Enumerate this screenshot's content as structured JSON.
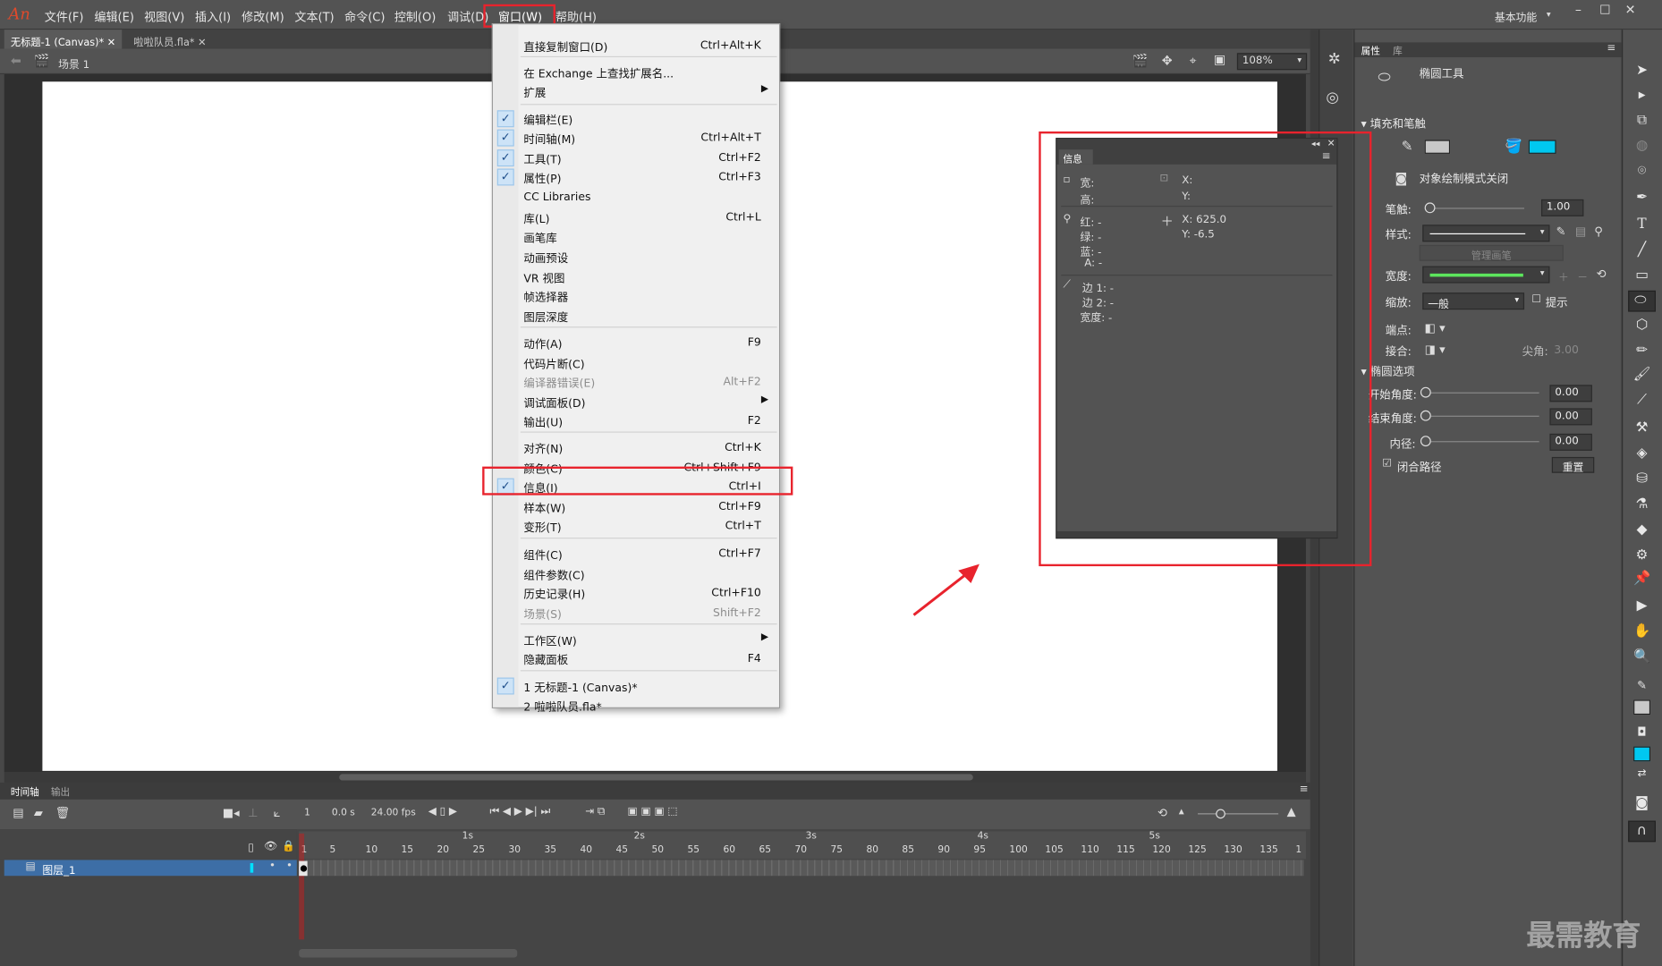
{
  "app": {
    "logo": "An",
    "accent": "#e8232d"
  },
  "menubar": {
    "items": [
      "文件(F)",
      "编辑(E)",
      "视图(V)",
      "插入(I)",
      "修改(M)",
      "文本(T)",
      "命令(C)",
      "控制(O)",
      "调试(D)",
      "窗口(W)",
      "帮助(H)"
    ],
    "workspace": "基本功能"
  },
  "doc_tabs": [
    "无标题-1 (Canvas)*",
    "啦啦队员.fla*"
  ],
  "scene": {
    "label": "场景 1",
    "zoom": "108%"
  },
  "window_menu": {
    "items": [
      {
        "label": "直接复制窗口(D)",
        "shortcut": "Ctrl+Alt+K"
      },
      {
        "label": "在 Exchange 上查找扩展名...",
        "shortcut": ""
      },
      {
        "label": "扩展",
        "shortcut": "",
        "submenu": true
      },
      {
        "label": "编辑栏(E)",
        "shortcut": "",
        "checked": true
      },
      {
        "label": "时间轴(M)",
        "shortcut": "Ctrl+Alt+T",
        "checked": true
      },
      {
        "label": "工具(T)",
        "shortcut": "Ctrl+F2",
        "checked": true
      },
      {
        "label": "属性(P)",
        "shortcut": "Ctrl+F3",
        "checked": true
      },
      {
        "label": "CC Libraries",
        "shortcut": ""
      },
      {
        "label": "库(L)",
        "shortcut": "Ctrl+L"
      },
      {
        "label": "画笔库",
        "shortcut": ""
      },
      {
        "label": "动画预设",
        "shortcut": ""
      },
      {
        "label": "VR 视图",
        "shortcut": ""
      },
      {
        "label": "帧选择器",
        "shortcut": ""
      },
      {
        "label": "图层深度",
        "shortcut": ""
      },
      {
        "label": "动作(A)",
        "shortcut": "F9"
      },
      {
        "label": "代码片断(C)",
        "shortcut": ""
      },
      {
        "label": "编译器错误(E)",
        "shortcut": "Alt+F2",
        "disabled": true
      },
      {
        "label": "调试面板(D)",
        "shortcut": "",
        "submenu": true
      },
      {
        "label": "输出(U)",
        "shortcut": "F2"
      },
      {
        "label": "对齐(N)",
        "shortcut": "Ctrl+K"
      },
      {
        "label": "颜色(C)",
        "shortcut": "Ctrl+Shift+F9"
      },
      {
        "label": "信息(I)",
        "shortcut": "Ctrl+I",
        "checked": true
      },
      {
        "label": "样本(W)",
        "shortcut": "Ctrl+F9"
      },
      {
        "label": "变形(T)",
        "shortcut": "Ctrl+T"
      },
      {
        "label": "组件(C)",
        "shortcut": "Ctrl+F7"
      },
      {
        "label": "组件参数(C)",
        "shortcut": ""
      },
      {
        "label": "历史记录(H)",
        "shortcut": "Ctrl+F10"
      },
      {
        "label": "场景(S)",
        "shortcut": "Shift+F2",
        "disabled": true
      },
      {
        "label": "工作区(W)",
        "shortcut": "",
        "submenu": true
      },
      {
        "label": "隐藏面板",
        "shortcut": "F4"
      },
      {
        "label": "1 无标题-1 (Canvas)*",
        "shortcut": "",
        "checked": true
      },
      {
        "label": "2 啦啦队员.fla*",
        "shortcut": ""
      }
    ]
  },
  "info_panel": {
    "title": "信息",
    "w_label": "宽:",
    "h_label": "高:",
    "x_label": "X:",
    "y_label": "Y:",
    "r_label": "红: -",
    "g_label": "绿: -",
    "b_label": "蓝: -",
    "a_label": "A: -",
    "x_value": "X: 625.0",
    "y_value": "Y: -6.5",
    "edge1": "边 1: -",
    "edge2": "边 2: -",
    "width": "宽度: -"
  },
  "properties": {
    "tabs": [
      "属性",
      "库"
    ],
    "tool_name": "椭圆工具",
    "fill_stroke": "填充和笔触",
    "fill_color": "#00c8f0",
    "object_draw": "对象绘制模式关闭",
    "stroke_label": "笔触:",
    "stroke_value": "1.00",
    "style_label": "样式:",
    "manage_brush": "管理画笔",
    "width_label": "宽度:",
    "scale_label": "缩放:",
    "scale_value": "一般",
    "hint": "提示",
    "cap_label": "端点:",
    "join_label": "接合:",
    "miter_label": "尖角:",
    "miter_value": "3.00",
    "ellipse_options": "椭圆选项",
    "start_angle": "开始角度:",
    "start_value": "0.00",
    "end_angle": "结束角度:",
    "end_value": "0.00",
    "inner_radius": "内径:",
    "inner_value": "0.00",
    "close_path": "闭合路径",
    "reset": "重置"
  },
  "timeline": {
    "tabs": [
      "时间轴",
      "输出"
    ],
    "frame": "1",
    "time": "0.0 s",
    "fps": "24.00 fps",
    "layer": "图层_1",
    "frame_numbers": [
      "1",
      "5",
      "10",
      "15",
      "20",
      "25",
      "30",
      "35",
      "40",
      "45",
      "50",
      "55",
      "60",
      "65",
      "70",
      "75",
      "80",
      "85",
      "90",
      "95",
      "100",
      "105",
      "110",
      "115",
      "120",
      "125",
      "130",
      "135",
      "1"
    ],
    "seconds": [
      "1s",
      "2s",
      "3s",
      "4s",
      "5s"
    ]
  },
  "watermark": "最需教育"
}
